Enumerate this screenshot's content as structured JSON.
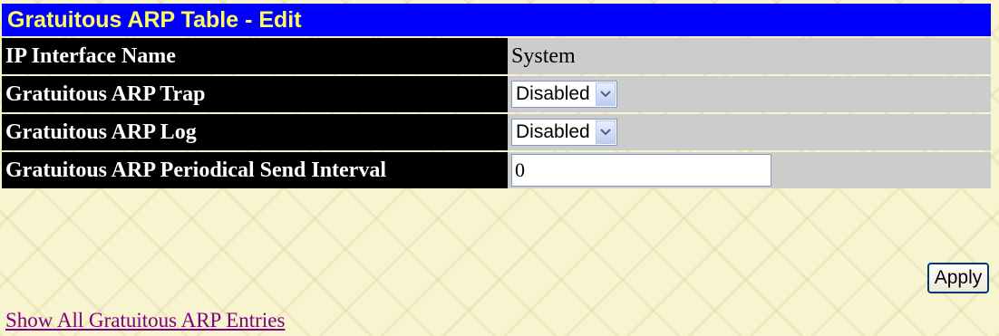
{
  "title": "Gratuitous ARP Table - Edit",
  "rows": [
    {
      "label": "IP Interface Name",
      "value": "System"
    },
    {
      "label": "Gratuitous ARP Trap",
      "selected": "Disabled"
    },
    {
      "label": "Gratuitous ARP Log",
      "selected": "Disabled"
    },
    {
      "label": "Gratuitous ARP Periodical Send Interval",
      "input_value": "0"
    }
  ],
  "apply_label": "Apply",
  "link_text": "Show All Gratuitous ARP Entries",
  "colors": {
    "title_bg": "#0000ff",
    "title_text": "#fffc5c",
    "label_bg": "#000000",
    "value_bg": "#cccccc",
    "link": "#800080"
  }
}
